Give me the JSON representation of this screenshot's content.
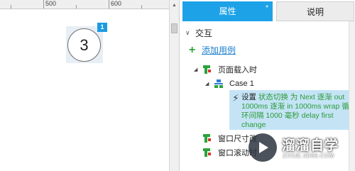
{
  "ruler": {
    "labels": [
      "500",
      "600",
      "7"
    ]
  },
  "canvas": {
    "widget_number": "3",
    "badge_number": "1"
  },
  "panel": {
    "tabs": [
      {
        "label": "属性",
        "marker": "*"
      },
      {
        "label": "说明"
      }
    ],
    "section_title": "交互",
    "add_case_label": "添加用例",
    "events": [
      {
        "label": "页面载入时"
      },
      {
        "label": "窗口尺寸改"
      },
      {
        "label": "窗口滚动时"
      }
    ],
    "case": {
      "label": "Case 1"
    },
    "action": {
      "verb": "设置",
      "detail": "状态切换 为 Next 逐渐 out 1000ms 逐渐 in 1000ms wrap 循环间隔 1000 毫秒 delay first change"
    }
  },
  "watermark": {
    "title": "溜溜自学",
    "url": "ZIXUE.3D66.COM"
  },
  "colors": {
    "accent": "#1da2e8",
    "action_highlight": "#c4e4f6",
    "action_text": "#2d9a3a"
  }
}
